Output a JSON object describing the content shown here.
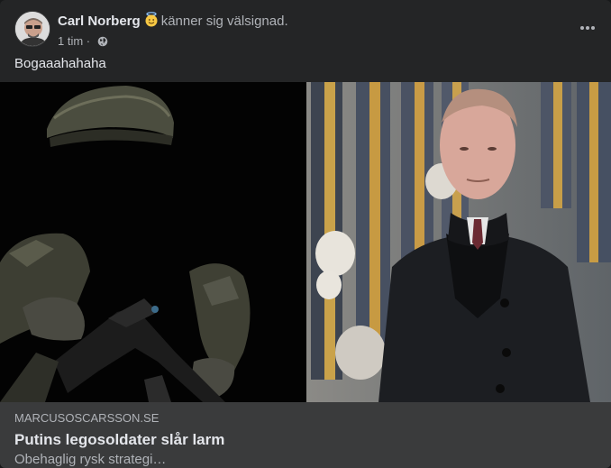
{
  "post": {
    "author": "Carl Norberg",
    "feeling_emoji": "halo-smiling-face-emoji",
    "feeling_text": "känner sig välsignad.",
    "time": "1 tim",
    "separator": " · ",
    "privacy_icon": "globe-icon",
    "text": "Bogaaahahaha"
  },
  "link_preview": {
    "domain": "MARCUSOSCARSSON.SE",
    "title": "Putins legosoldater slår larm",
    "description": "Obehaglig rysk strategi…"
  },
  "colors": {
    "card_bg": "#242526",
    "link_box_bg": "#3a3b3c",
    "primary_text": "#e4e6eb",
    "secondary_text": "#b0b3b8"
  }
}
